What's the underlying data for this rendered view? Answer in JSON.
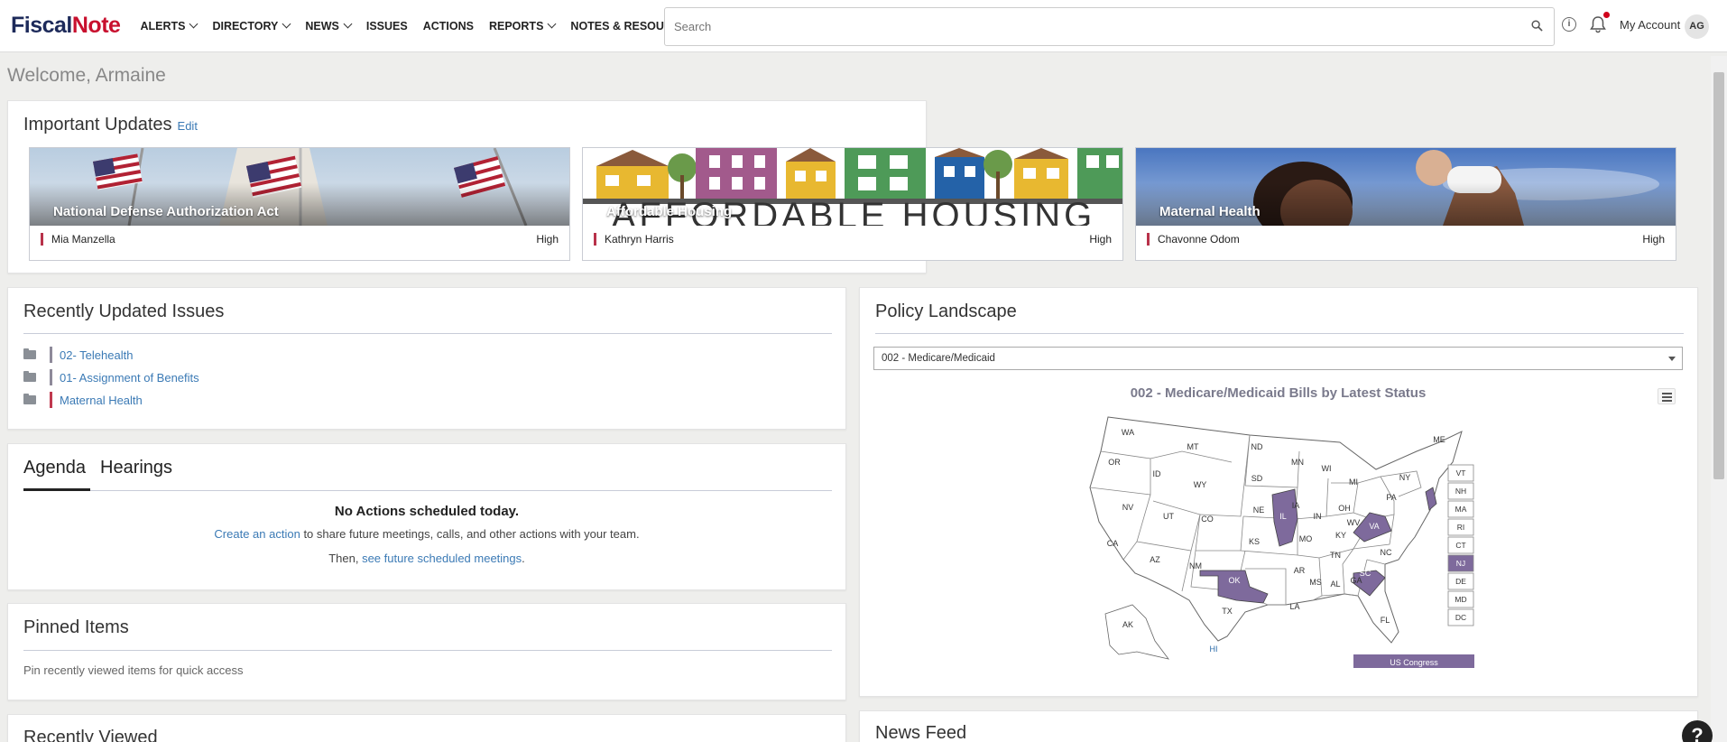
{
  "header": {
    "logo_part1": "Fiscal",
    "logo_part2": "Note",
    "nav": [
      {
        "label": "ALERTS",
        "dropdown": true
      },
      {
        "label": "DIRECTORY",
        "dropdown": true
      },
      {
        "label": "NEWS",
        "dropdown": true
      },
      {
        "label": "ISSUES",
        "dropdown": false
      },
      {
        "label": "ACTIONS",
        "dropdown": false
      },
      {
        "label": "REPORTS",
        "dropdown": true
      },
      {
        "label": "NOTES & RESOURCES",
        "dropdown": true
      }
    ],
    "search_placeholder": "Search",
    "account_label": "My Account",
    "avatar_initials": "AG"
  },
  "welcome": "Welcome, Armaine",
  "important_updates": {
    "title": "Important Updates",
    "edit_label": "Edit",
    "cards": [
      {
        "title": "National Defense Authorization Act",
        "person": "Mia Manzella",
        "priority": "High"
      },
      {
        "title": "Affordable Housing",
        "person": "Kathryn Harris",
        "priority": "High",
        "image_text": "AFFORDABLE HOUSING"
      },
      {
        "title": "Maternal Health",
        "person": "Chavonne Odom",
        "priority": "High"
      }
    ]
  },
  "recent_issues": {
    "title": "Recently Updated Issues",
    "items": [
      {
        "label": "02- Telehealth",
        "color": "#8e8a9a"
      },
      {
        "label": "01- Assignment of Benefits",
        "color": "#8e8a9a"
      },
      {
        "label": "Maternal Health",
        "color": "#c0394f"
      }
    ]
  },
  "agenda": {
    "tab_agenda": "Agenda",
    "tab_hearings": "Hearings",
    "empty_title": "No Actions scheduled today.",
    "create_link": "Create an action",
    "create_rest": " to share future meetings, calls, and other actions with your team.",
    "then_text": "Then, ",
    "future_link": "see future scheduled meetings",
    "period": "."
  },
  "pinned": {
    "title": "Pinned Items",
    "text": "Pin recently viewed items for quick access"
  },
  "recently_viewed": {
    "title": "Recently Viewed"
  },
  "policy": {
    "title": "Policy Landscape",
    "select_value": "002 - Medicare/Medicaid",
    "map_title": "002 - Medicare/Medicaid Bills by Latest Status",
    "highlight_color": "#7e6a9c",
    "highlighted_states": [
      "IL",
      "OK",
      "VA",
      "SC",
      "NJ"
    ],
    "states": [
      "WA",
      "OR",
      "CA",
      "ID",
      "NV",
      "MT",
      "WY",
      "UT",
      "AZ",
      "CO",
      "NM",
      "ND",
      "SD",
      "NE",
      "KS",
      "OK",
      "TX",
      "MN",
      "IA",
      "MO",
      "AR",
      "LA",
      "WI",
      "IL",
      "MI",
      "IN",
      "OH",
      "KY",
      "TN",
      "MS",
      "AL",
      "GA",
      "FL",
      "SC",
      "NC",
      "VA",
      "WV",
      "PA",
      "NY",
      "ME",
      "AK",
      "HI"
    ],
    "small_states": [
      "VT",
      "NH",
      "MA",
      "RI",
      "CT",
      "NJ",
      "DE",
      "MD",
      "DC"
    ],
    "us_congress": "US Congress"
  },
  "news_feed": {
    "title": "News Feed"
  },
  "help_label": "?"
}
